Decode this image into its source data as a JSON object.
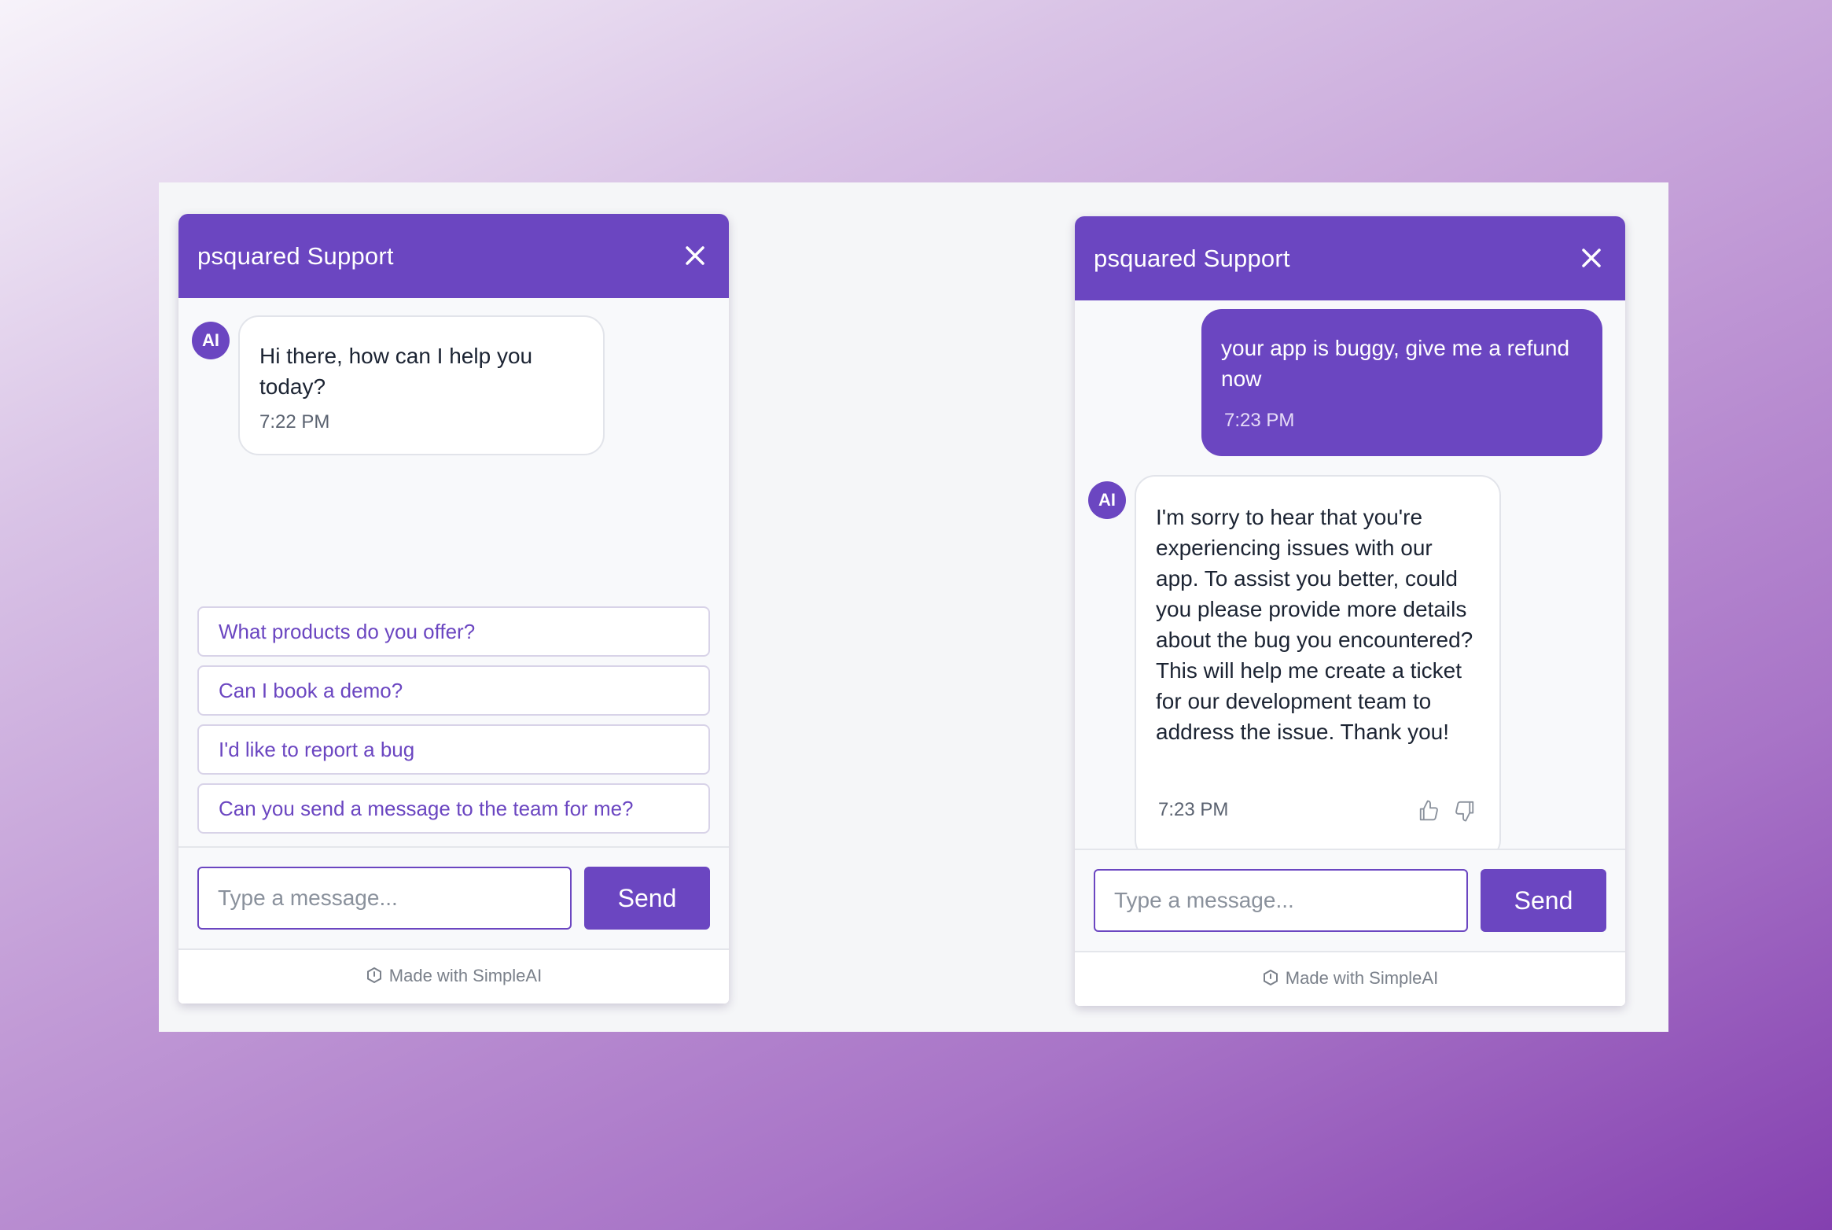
{
  "widgets": [
    {
      "title": "psquared Support",
      "avatar": "AI",
      "bot_message": {
        "text": "Hi there, how can I help you today?",
        "time": "7:22 PM"
      },
      "suggestions": [
        "What products do you offer?",
        "Can I book a demo?",
        "I'd like to report a bug",
        "Can you send a message to the team for me?"
      ],
      "input_placeholder": "Type a message...",
      "send_label": "Send",
      "footer": "Made with SimpleAI"
    },
    {
      "title": "psquared Support",
      "avatar": "AI",
      "user_message": {
        "text": "your app is buggy, give me a refund now",
        "time": "7:23 PM"
      },
      "bot_message": {
        "text": "I'm sorry to hear that you're experiencing issues with our app. To assist you better, could you please provide more details about the bug you encountered? This will help me create a ticket for our development team to address the issue. Thank you!",
        "time": "7:23 PM"
      },
      "input_placeholder": "Type a message...",
      "send_label": "Send",
      "footer": "Made with SimpleAI"
    }
  ],
  "colors": {
    "accent": "#6b46c1",
    "background": "#f5f6f8"
  },
  "icons": {
    "close": "close-icon",
    "thumbs_up": "thumbs-up-icon",
    "thumbs_down": "thumbs-down-icon",
    "brand": "simpleai-logo-icon"
  }
}
